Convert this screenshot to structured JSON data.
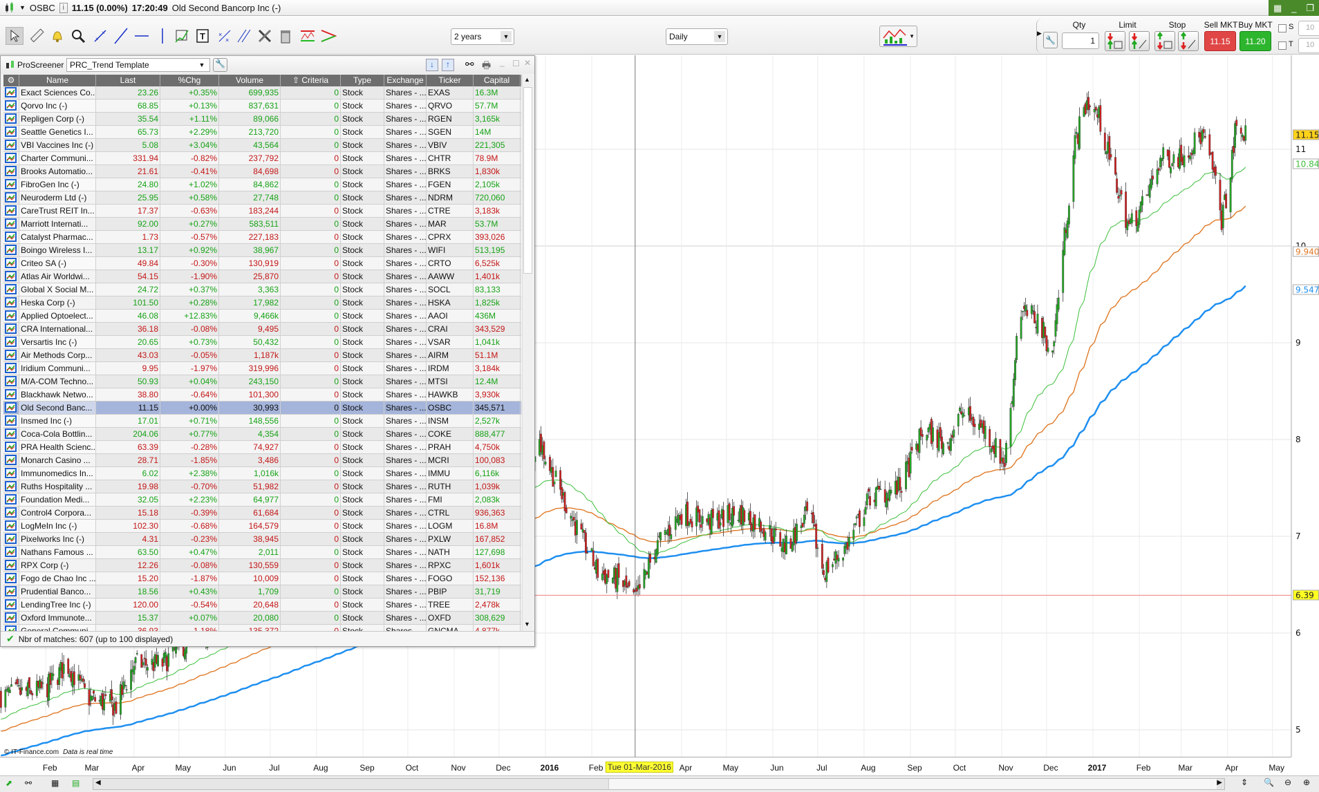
{
  "titlebar": {
    "ticker": "OSBC",
    "price_info": "11.15 (0.00%)",
    "time": "17:20:49",
    "instrument": "Old Second Bancorp Inc (-)"
  },
  "toolbar": {
    "period": "2 years",
    "timeframe": "Daily",
    "qty_label": "Qty",
    "qty_value": "1",
    "limit_label": "Limit",
    "stop_label": "Stop",
    "sell_label": "Sell MKT",
    "buy_label": "Buy MKT",
    "sell_price": "11.15",
    "buy_price": "11.20",
    "s_label": "S",
    "t_label": "T",
    "s_value": "10",
    "t_value": "10"
  },
  "screener": {
    "title": "ProScreener",
    "template": "PRC_Trend Template",
    "columns": [
      "Name",
      "Last",
      "%Chg",
      "Volume",
      "Criteria",
      "Type",
      "Exchange",
      "Ticker",
      "Capital"
    ],
    "rows": [
      [
        "Exact Sciences Co...",
        "23.26",
        "+0.35%",
        "699,935",
        "0",
        "Stock",
        "Shares - ...",
        "EXAS",
        "16.3M",
        "up"
      ],
      [
        "Qorvo Inc (-)",
        "68.85",
        "+0.13%",
        "837,631",
        "0",
        "Stock",
        "Shares - ...",
        "QRVO",
        "57.7M",
        "up"
      ],
      [
        "Repligen Corp (-)",
        "35.54",
        "+1.11%",
        "89,066",
        "0",
        "Stock",
        "Shares - ...",
        "RGEN",
        "3,165k",
        "up"
      ],
      [
        "Seattle Genetics I...",
        "65.73",
        "+2.29%",
        "213,720",
        "0",
        "Stock",
        "Shares - ...",
        "SGEN",
        "14M",
        "up"
      ],
      [
        "VBI Vaccines Inc (-)",
        "5.08",
        "+3.04%",
        "43,564",
        "0",
        "Stock",
        "Shares - ...",
        "VBIV",
        "221,305",
        "up"
      ],
      [
        "Charter Communi...",
        "331.94",
        "-0.82%",
        "237,792",
        "0",
        "Stock",
        "Shares - ...",
        "CHTR",
        "78.9M",
        "dn"
      ],
      [
        "Brooks Automatio...",
        "21.61",
        "-0.41%",
        "84,698",
        "0",
        "Stock",
        "Shares - ...",
        "BRKS",
        "1,830k",
        "dn"
      ],
      [
        "FibroGen Inc (-)",
        "24.80",
        "+1.02%",
        "84,862",
        "0",
        "Stock",
        "Shares - ...",
        "FGEN",
        "2,105k",
        "up"
      ],
      [
        "Neuroderm Ltd (-)",
        "25.95",
        "+0.58%",
        "27,748",
        "0",
        "Stock",
        "Shares - ...",
        "NDRM",
        "720,060",
        "up"
      ],
      [
        "CareTrust REIT In...",
        "17.37",
        "-0.63%",
        "183,244",
        "0",
        "Stock",
        "Shares - ...",
        "CTRE",
        "3,183k",
        "dn"
      ],
      [
        "Marriott Internati...",
        "92.00",
        "+0.27%",
        "583,511",
        "0",
        "Stock",
        "Shares - ...",
        "MAR",
        "53.7M",
        "up"
      ],
      [
        "Catalyst Pharmac...",
        "1.73",
        "-0.57%",
        "227,183",
        "0",
        "Stock",
        "Shares - ...",
        "CPRX",
        "393,026",
        "dn"
      ],
      [
        "Boingo Wireless I...",
        "13.17",
        "+0.92%",
        "38,967",
        "0",
        "Stock",
        "Shares - ...",
        "WIFI",
        "513,195",
        "up"
      ],
      [
        "Criteo SA (-)",
        "49.84",
        "-0.30%",
        "130,919",
        "0",
        "Stock",
        "Shares - ...",
        "CRTO",
        "6,525k",
        "dn"
      ],
      [
        "Atlas Air Worldwi...",
        "54.15",
        "-1.90%",
        "25,870",
        "0",
        "Stock",
        "Shares - ...",
        "AAWW",
        "1,401k",
        "dn"
      ],
      [
        "Global X Social M...",
        "24.72",
        "+0.37%",
        "3,363",
        "0",
        "Stock",
        "Shares - ...",
        "SOCL",
        "83,133",
        "up"
      ],
      [
        "Heska Corp (-)",
        "101.50",
        "+0.28%",
        "17,982",
        "0",
        "Stock",
        "Shares - ...",
        "HSKA",
        "1,825k",
        "up"
      ],
      [
        "Applied Optoelect...",
        "46.08",
        "+12.83%",
        "9,466k",
        "0",
        "Stock",
        "Shares - ...",
        "AAOI",
        "436M",
        "up"
      ],
      [
        "CRA International...",
        "36.18",
        "-0.08%",
        "9,495",
        "0",
        "Stock",
        "Shares - ...",
        "CRAI",
        "343,529",
        "dn"
      ],
      [
        "Versartis Inc (-)",
        "20.65",
        "+0.73%",
        "50,432",
        "0",
        "Stock",
        "Shares - ...",
        "VSAR",
        "1,041k",
        "up"
      ],
      [
        "Air Methods Corp...",
        "43.03",
        "-0.05%",
        "1,187k",
        "0",
        "Stock",
        "Shares - ...",
        "AIRM",
        "51.1M",
        "dn"
      ],
      [
        "Iridium Communi...",
        "9.95",
        "-1.97%",
        "319,996",
        "0",
        "Stock",
        "Shares - ...",
        "IRDM",
        "3,184k",
        "dn"
      ],
      [
        "M/A-COM Techno...",
        "50.93",
        "+0.04%",
        "243,150",
        "0",
        "Stock",
        "Shares - ...",
        "MTSI",
        "12.4M",
        "up"
      ],
      [
        "Blackhawk Netwo...",
        "38.80",
        "-0.64%",
        "101,300",
        "0",
        "Stock",
        "Shares - ...",
        "HAWKB",
        "3,930k",
        "dn"
      ],
      [
        "Old Second Banc...",
        "11.15",
        "+0.00%",
        "30,993",
        "0",
        "Stock",
        "Shares - ...",
        "OSBC",
        "345,571",
        "sel"
      ],
      [
        "Insmed Inc (-)",
        "17.01",
        "+0.71%",
        "148,556",
        "0",
        "Stock",
        "Shares - ...",
        "INSM",
        "2,527k",
        "up"
      ],
      [
        "Coca-Cola Bottlin...",
        "204.06",
        "+0.77%",
        "4,354",
        "0",
        "Stock",
        "Shares - ...",
        "COKE",
        "888,477",
        "up"
      ],
      [
        "PRA Health Scienc...",
        "63.39",
        "-0.28%",
        "74,927",
        "0",
        "Stock",
        "Shares - ...",
        "PRAH",
        "4,750k",
        "dn"
      ],
      [
        "Monarch Casino ...",
        "28.71",
        "-1.85%",
        "3,486",
        "0",
        "Stock",
        "Shares - ...",
        "MCRI",
        "100,083",
        "dn"
      ],
      [
        "Immunomedics In...",
        "6.02",
        "+2.38%",
        "1,016k",
        "0",
        "Stock",
        "Shares - ...",
        "IMMU",
        "6,116k",
        "up"
      ],
      [
        "Ruths Hospitality ...",
        "19.98",
        "-0.70%",
        "51,982",
        "0",
        "Stock",
        "Shares - ...",
        "RUTH",
        "1,039k",
        "dn"
      ],
      [
        "Foundation Medi...",
        "32.05",
        "+2.23%",
        "64,977",
        "0",
        "Stock",
        "Shares - ...",
        "FMI",
        "2,083k",
        "up"
      ],
      [
        "Control4 Corpora...",
        "15.18",
        "-0.39%",
        "61,684",
        "0",
        "Stock",
        "Shares - ...",
        "CTRL",
        "936,363",
        "dn"
      ],
      [
        "LogMeIn Inc (-)",
        "102.30",
        "-0.68%",
        "164,579",
        "0",
        "Stock",
        "Shares - ...",
        "LOGM",
        "16.8M",
        "dn"
      ],
      [
        "Pixelworks Inc (-)",
        "4.31",
        "-0.23%",
        "38,945",
        "0",
        "Stock",
        "Shares - ...",
        "PXLW",
        "167,852",
        "dn"
      ],
      [
        "Nathans Famous ...",
        "63.50",
        "+0.47%",
        "2,011",
        "0",
        "Stock",
        "Shares - ...",
        "NATH",
        "127,698",
        "up"
      ],
      [
        "RPX Corp (-)",
        "12.26",
        "-0.08%",
        "130,559",
        "0",
        "Stock",
        "Shares - ...",
        "RPXC",
        "1,601k",
        "dn"
      ],
      [
        "Fogo de Chao Inc ...",
        "15.20",
        "-1.87%",
        "10,009",
        "0",
        "Stock",
        "Shares - ...",
        "FOGO",
        "152,136",
        "dn"
      ],
      [
        "Prudential Banco...",
        "18.56",
        "+0.43%",
        "1,709",
        "0",
        "Stock",
        "Shares - ...",
        "PBIP",
        "31,719",
        "up"
      ],
      [
        "LendingTree Inc (-)",
        "120.00",
        "-0.54%",
        "20,648",
        "0",
        "Stock",
        "Shares - ...",
        "TREE",
        "2,478k",
        "dn"
      ],
      [
        "Oxford Immunote...",
        "15.37",
        "+0.07%",
        "20,080",
        "0",
        "Stock",
        "Shares - ...",
        "OXFD",
        "308,629",
        "up"
      ],
      [
        "General Communi...",
        "36.93",
        "-1.18%",
        "135,372",
        "0",
        "Stock",
        "Shares - ...",
        "GNCMA",
        "4,877k",
        "dn"
      ]
    ],
    "status": "Nbr of matches: 607 (up to 100 displayed)"
  },
  "chart": {
    "colors": {
      "up": "#22a822",
      "down": "#d42020",
      "ma_short": "#3cbf3c",
      "ma_mid": "#e07a28",
      "ma_long": "#1e8ff0",
      "support": "#f08080"
    },
    "price_ticks": [
      "5",
      "6",
      "7",
      "8",
      "9",
      "10",
      "11"
    ],
    "last_price": "11.15",
    "ma_short_value": "10.848",
    "ma_mid_value": "9.9406",
    "ma_long_value": "9.5474",
    "support_level": "6.39",
    "crosshair_date": "Tue 01-Mar-2016",
    "copyright": "© IT-Finance.com",
    "realtime_note": "Data is real time",
    "date_labels": [
      [
        "Feb",
        "2015-02-01"
      ],
      [
        "Mar",
        "2015-03-01"
      ],
      [
        "Apr",
        "2015-04-01"
      ],
      [
        "May",
        "2015-05-01"
      ],
      [
        "Jun",
        "2015-06-01"
      ],
      [
        "Jul",
        "2015-07-01"
      ],
      [
        "Aug",
        "2015-08-01"
      ],
      [
        "Sep",
        "2015-09-01"
      ],
      [
        "Oct",
        "2015-10-01"
      ],
      [
        "Nov",
        "2015-11-01"
      ],
      [
        "Dec",
        "2015-12-01"
      ],
      [
        "2016",
        "2016-01-01"
      ],
      [
        "Feb",
        "2016-02-01"
      ],
      [
        "Apr",
        "2016-04-01"
      ],
      [
        "May",
        "2016-05-01"
      ],
      [
        "Jun",
        "2016-06-01"
      ],
      [
        "Jul",
        "2016-07-01"
      ],
      [
        "Aug",
        "2016-08-01"
      ],
      [
        "Sep",
        "2016-09-01"
      ],
      [
        "Oct",
        "2016-10-01"
      ],
      [
        "Nov",
        "2016-11-01"
      ],
      [
        "Dec",
        "2016-12-01"
      ],
      [
        "2017",
        "2017-01-01"
      ],
      [
        "Feb",
        "2017-02-01"
      ],
      [
        "Mar",
        "2017-03-01"
      ],
      [
        "Apr",
        "2017-04-01"
      ],
      [
        "May",
        "2017-05-01"
      ]
    ],
    "price_path": [
      [
        "2015-01-02",
        5.35
      ],
      [
        "2015-02-01",
        5.42
      ],
      [
        "2015-02-15",
        5.68
      ],
      [
        "2015-03-01",
        5.33
      ],
      [
        "2015-03-20",
        5.24
      ],
      [
        "2015-04-01",
        5.68
      ],
      [
        "2015-04-20",
        5.68
      ],
      [
        "2015-05-01",
        5.85
      ],
      [
        "2015-06-15",
        6.2
      ],
      [
        "2015-08-15",
        6.6
      ],
      [
        "2015-10-15",
        7.0
      ],
      [
        "2015-12-01",
        7.6
      ],
      [
        "2015-12-28",
        7.98
      ],
      [
        "2016-01-05",
        7.67
      ],
      [
        "2016-01-20",
        7.15
      ],
      [
        "2016-02-05",
        6.63
      ],
      [
        "2016-02-20",
        6.54
      ],
      [
        "2016-03-01",
        6.33
      ],
      [
        "2016-03-15",
        6.89
      ],
      [
        "2016-04-01",
        7.24
      ],
      [
        "2016-04-20",
        7.15
      ],
      [
        "2016-05-10",
        7.24
      ],
      [
        "2016-05-25",
        7.11
      ],
      [
        "2016-06-10",
        6.89
      ],
      [
        "2016-06-25",
        7.24
      ],
      [
        "2016-07-05",
        6.63
      ],
      [
        "2016-07-20",
        6.89
      ],
      [
        "2016-08-05",
        7.41
      ],
      [
        "2016-08-25",
        7.5
      ],
      [
        "2016-09-10",
        8.11
      ],
      [
        "2016-09-25",
        7.94
      ],
      [
        "2016-10-05",
        8.28
      ],
      [
        "2016-10-20",
        8.11
      ],
      [
        "2016-11-03",
        7.76
      ],
      [
        "2016-11-09",
        8.63
      ],
      [
        "2016-11-12",
        9.33
      ],
      [
        "2016-11-25",
        9.24
      ],
      [
        "2016-12-05",
        8.89
      ],
      [
        "2016-12-10",
        9.67
      ],
      [
        "2016-12-15",
        10.37
      ],
      [
        "2016-12-20",
        11.06
      ],
      [
        "2016-12-28",
        11.5
      ],
      [
        "2017-01-05",
        11.33
      ],
      [
        "2017-01-15",
        10.72
      ],
      [
        "2017-01-25",
        10.2
      ],
      [
        "2017-02-05",
        10.46
      ],
      [
        "2017-02-15",
        10.9
      ],
      [
        "2017-03-01",
        10.93
      ],
      [
        "2017-03-15",
        11.15
      ],
      [
        "2017-03-22",
        10.8
      ],
      [
        "2017-03-28",
        10.28
      ],
      [
        "2017-04-03",
        10.72
      ],
      [
        "2017-04-06",
        11.2
      ],
      [
        "2017-04-13",
        11.15
      ]
    ]
  }
}
